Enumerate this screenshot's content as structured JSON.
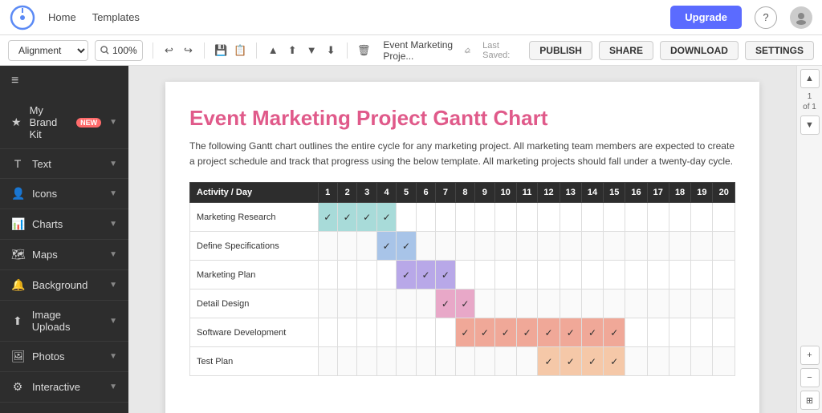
{
  "topnav": {
    "home_label": "Home",
    "templates_label": "Templates",
    "upgrade_label": "Upgrade",
    "help_label": "?",
    "filename": "Event Marketing Proje...",
    "last_saved": "Last Saved:"
  },
  "toolbar": {
    "alignment_label": "Alignment",
    "zoom_label": "100%",
    "publish_label": "PUBLISH",
    "share_label": "SHARE",
    "download_label": "DOWNLOAD",
    "settings_label": "SETTINGS"
  },
  "sidebar": {
    "hamburger": "≡",
    "items": [
      {
        "id": "my-brand-kit",
        "label": "My Brand Kit",
        "icon": "★",
        "badge": "NEW"
      },
      {
        "id": "text",
        "label": "Text",
        "icon": "T"
      },
      {
        "id": "icons",
        "label": "Icons",
        "icon": "👤"
      },
      {
        "id": "charts",
        "label": "Charts",
        "icon": "📊"
      },
      {
        "id": "maps",
        "label": "Maps",
        "icon": "🗺"
      },
      {
        "id": "background",
        "label": "Background",
        "icon": "🔔"
      },
      {
        "id": "image-uploads",
        "label": "Image Uploads",
        "icon": "⬆"
      },
      {
        "id": "photos",
        "label": "Photos",
        "icon": "🖼"
      },
      {
        "id": "interactive",
        "label": "Interactive",
        "icon": "⚙"
      }
    ]
  },
  "canvas": {
    "title": "Event Marketing Project Gantt Chart",
    "description": "The following Gantt chart outlines the entire cycle for any marketing project. All marketing team members are expected to create a project schedule and track that progress using the below template. All marketing projects should fall under a twenty-day cycle.",
    "page_current": "1",
    "page_of": "of 1"
  },
  "gantt": {
    "header": [
      "Activity / Day",
      "1",
      "2",
      "3",
      "4",
      "5",
      "6",
      "7",
      "8",
      "9",
      "10",
      "11",
      "12",
      "13",
      "14",
      "15",
      "16",
      "17",
      "18",
      "19",
      "20"
    ],
    "rows": [
      {
        "activity": "Marketing Research",
        "cells": [
          {
            "col": 1,
            "class": "cell-teal",
            "check": true
          },
          {
            "col": 2,
            "class": "cell-teal",
            "check": true
          },
          {
            "col": 3,
            "class": "cell-teal",
            "check": true
          },
          {
            "col": 4,
            "class": "cell-teal",
            "check": true
          }
        ]
      },
      {
        "activity": "Define Specifications",
        "cells": [
          {
            "col": 4,
            "class": "cell-blue",
            "check": true
          },
          {
            "col": 5,
            "class": "cell-blue",
            "check": true
          }
        ]
      },
      {
        "activity": "Marketing Plan",
        "cells": [
          {
            "col": 5,
            "class": "cell-purple",
            "check": true
          },
          {
            "col": 6,
            "class": "cell-purple",
            "check": true
          },
          {
            "col": 7,
            "class": "cell-purple",
            "check": true
          }
        ]
      },
      {
        "activity": "Detail Design",
        "cells": [
          {
            "col": 7,
            "class": "cell-pink",
            "check": true
          },
          {
            "col": 8,
            "class": "cell-pink",
            "check": true
          }
        ]
      },
      {
        "activity": "Software Development",
        "cells": [
          {
            "col": 8,
            "class": "cell-salmon",
            "check": true
          },
          {
            "col": 9,
            "class": "cell-salmon",
            "check": true
          },
          {
            "col": 10,
            "class": "cell-salmon",
            "check": true
          },
          {
            "col": 11,
            "class": "cell-salmon",
            "check": true
          },
          {
            "col": 12,
            "class": "cell-salmon",
            "check": true
          },
          {
            "col": 13,
            "class": "cell-salmon",
            "check": true
          },
          {
            "col": 14,
            "class": "cell-salmon",
            "check": true
          },
          {
            "col": 15,
            "class": "cell-salmon",
            "check": true
          }
        ]
      },
      {
        "activity": "Test Plan",
        "cells": [
          {
            "col": 12,
            "class": "cell-peach",
            "check": true
          },
          {
            "col": 13,
            "class": "cell-peach",
            "check": true
          },
          {
            "col": 14,
            "class": "cell-peach",
            "check": true
          },
          {
            "col": 15,
            "class": "cell-peach",
            "check": true
          }
        ]
      }
    ]
  }
}
